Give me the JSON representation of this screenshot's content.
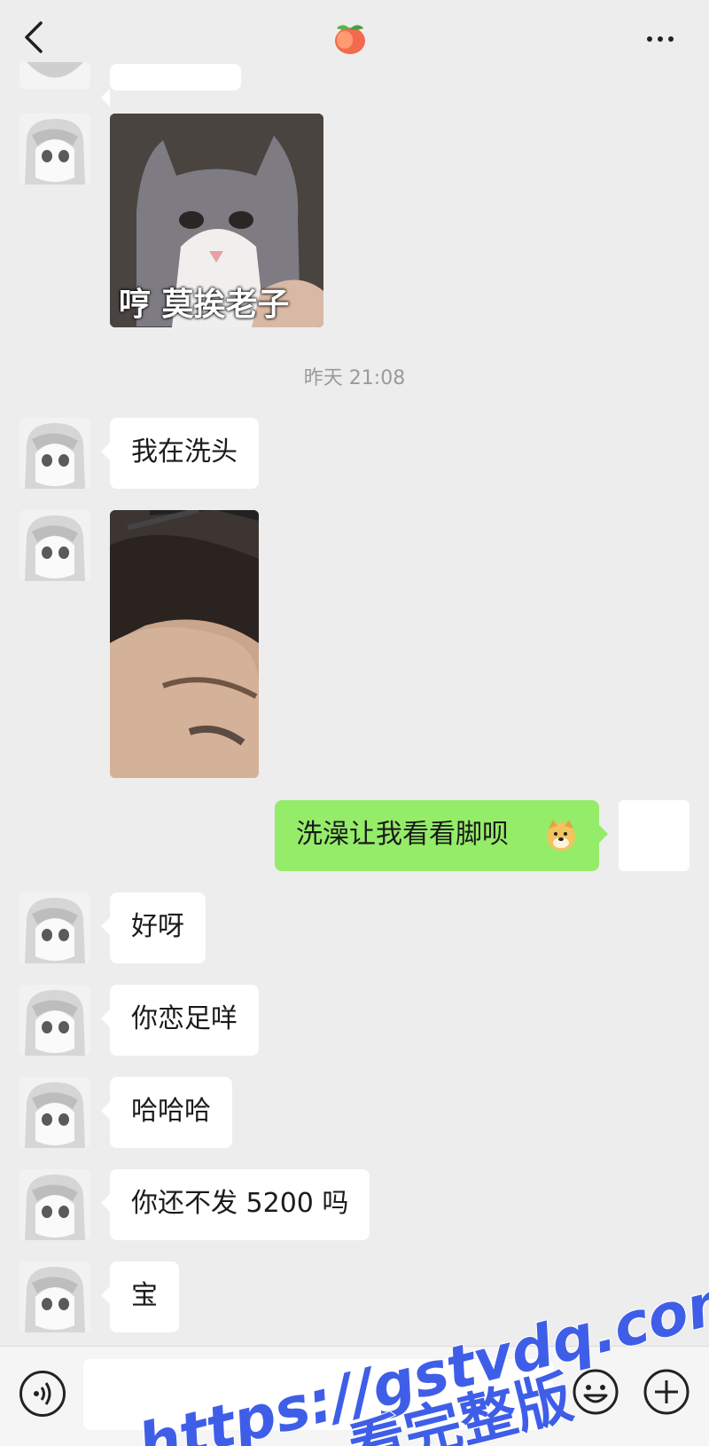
{
  "header": {
    "back_icon": "chevron-left-icon",
    "title_icon": "peach-icon",
    "more_icon": "more-horizontal-icon"
  },
  "messages": {
    "sticker_cat_caption": "哼 莫挨老子",
    "timestamp": "昨天 21:08",
    "msg1": "我在洗头",
    "msg_self": "洗澡让我看看脚呗",
    "msg2": "好呀",
    "msg3": "你恋足咩",
    "msg4": "哈哈哈",
    "msg5": "你还不发 5200 吗",
    "msg6": "宝"
  },
  "composer": {
    "voice_icon": "voice-icon",
    "emoji_icon": "smile-icon",
    "plus_icon": "plus-icon"
  },
  "watermark": {
    "line1": "https://gstvdq.com",
    "line2": "看完整版"
  },
  "colors": {
    "background": "#ededed",
    "bubble_left": "#ffffff",
    "bubble_right": "#95ec69",
    "watermark": "#3f5ee8"
  }
}
